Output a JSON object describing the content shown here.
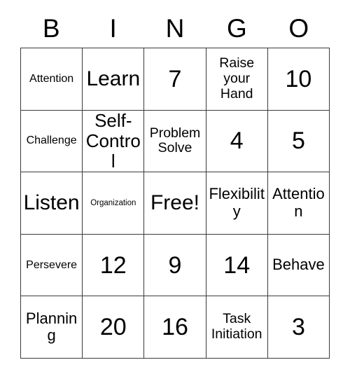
{
  "card": {
    "title_letters": [
      "B",
      "I",
      "N",
      "G",
      "O"
    ],
    "columns": 5,
    "rows": 5,
    "border_color": "#3a3a3a",
    "background_color": "#ffffff",
    "text_color": "#000000",
    "free_space_label": "Free!",
    "free_space_position": {
      "row": 3,
      "column": 3
    },
    "cells": [
      [
        {
          "text": "Attention",
          "size": "s"
        },
        {
          "text": "Learn",
          "size": "xl"
        },
        {
          "text": "7",
          "size": "num"
        },
        {
          "text": "Raise your Hand",
          "size": "m"
        },
        {
          "text": "10",
          "size": "num"
        }
      ],
      [
        {
          "text": "Challenge",
          "size": "s"
        },
        {
          "text": "Self-Control",
          "size": "l"
        },
        {
          "text": "Problem Solve",
          "size": "m"
        },
        {
          "text": "4",
          "size": "num"
        },
        {
          "text": "5",
          "size": "num"
        }
      ],
      [
        {
          "text": "Listen",
          "size": "xl"
        },
        {
          "text": "Organization",
          "size": "xs"
        },
        {
          "text": "Free!",
          "size": "xl"
        },
        {
          "text": "Flexibility",
          "size": "ml"
        },
        {
          "text": "Attention",
          "size": "ml"
        }
      ],
      [
        {
          "text": "Persevere",
          "size": "s"
        },
        {
          "text": "12",
          "size": "num"
        },
        {
          "text": "9",
          "size": "num"
        },
        {
          "text": "14",
          "size": "num"
        },
        {
          "text": "Behave",
          "size": "ml"
        }
      ],
      [
        {
          "text": "Planning",
          "size": "ml"
        },
        {
          "text": "20",
          "size": "num"
        },
        {
          "text": "16",
          "size": "num"
        },
        {
          "text": "Task Initiation",
          "size": "m"
        },
        {
          "text": "3",
          "size": "num"
        }
      ]
    ]
  }
}
